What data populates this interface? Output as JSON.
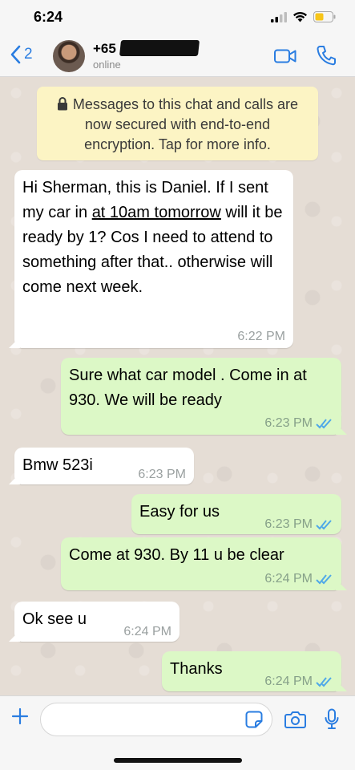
{
  "status_bar": {
    "time": "6:24"
  },
  "header": {
    "back_count": "2",
    "contact_name": "+65",
    "contact_status": "online"
  },
  "banner": {
    "text": "Messages to this chat and calls are now secured with end-to-end encryption. Tap for more info."
  },
  "messages": [
    {
      "direction": "in",
      "parts": [
        "Hi Sherman, this is Daniel. If I sent my car in ",
        "at 10am tomorrow",
        " will it be ready by 1? Cos I need to attend to something after that.. otherwise will come next week."
      ],
      "time": "6:22 PM"
    },
    {
      "direction": "out",
      "text": "Sure what car model . Come in at 930. We will be ready",
      "time": "6:23 PM",
      "read": true
    },
    {
      "direction": "in",
      "text": "Bmw 523i",
      "time": "6:23 PM"
    },
    {
      "direction": "out",
      "text": "Easy for us",
      "time": "6:23 PM",
      "read": true
    },
    {
      "direction": "out",
      "text": "Come at 930. By 11 u be clear",
      "time": "6:24 PM",
      "read": true
    },
    {
      "direction": "in",
      "text": "Ok see u",
      "time": "6:24 PM"
    },
    {
      "direction": "out",
      "text": "Thanks",
      "time": "6:24 PM",
      "read": true
    }
  ],
  "composer": {
    "placeholder": ""
  },
  "colors": {
    "accent": "#2a7de1",
    "outgoing": "#dcf8c6",
    "incoming": "#ffffff",
    "read_ticks": "#4fa8e8",
    "banner": "#fcf4c4"
  }
}
